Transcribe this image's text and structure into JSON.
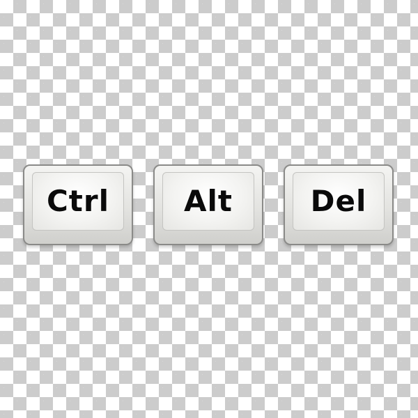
{
  "keys": [
    {
      "label": "Ctrl"
    },
    {
      "label": "Alt"
    },
    {
      "label": "Del"
    }
  ],
  "colors": {
    "checker_light": "#ffffff",
    "checker_dark": "#cccccc",
    "key_border": "#8a8a88",
    "key_label": "#0a0a0a"
  }
}
